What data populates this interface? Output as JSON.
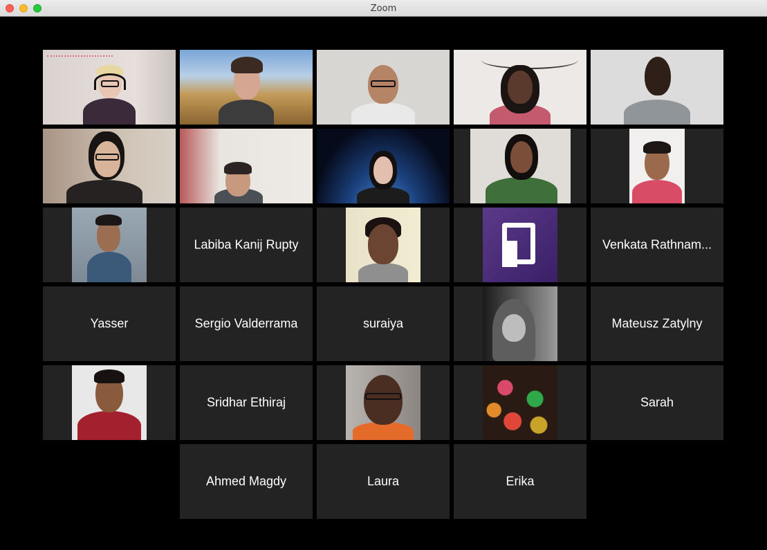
{
  "window": {
    "title": "Zoom"
  },
  "participants": [
    {
      "name": "",
      "type": "video",
      "active": true
    },
    {
      "name": "",
      "type": "video"
    },
    {
      "name": "",
      "type": "video"
    },
    {
      "name": "",
      "type": "video"
    },
    {
      "name": "",
      "type": "video"
    },
    {
      "name": "",
      "type": "video"
    },
    {
      "name": "",
      "type": "video"
    },
    {
      "name": "",
      "type": "video"
    },
    {
      "name": "",
      "type": "video"
    },
    {
      "name": "",
      "type": "video"
    },
    {
      "name": "",
      "type": "photo"
    },
    {
      "name": "Labiba Kanij Rupty",
      "type": "name"
    },
    {
      "name": "",
      "type": "photo"
    },
    {
      "name": "",
      "type": "logo"
    },
    {
      "name": "Venkata Rathnam...",
      "type": "name"
    },
    {
      "name": "Yasser",
      "type": "name"
    },
    {
      "name": "Sergio Valderrama",
      "type": "name"
    },
    {
      "name": "suraiya",
      "type": "name"
    },
    {
      "name": "",
      "type": "photo"
    },
    {
      "name": "Mateusz Zatylny",
      "type": "name"
    },
    {
      "name": "",
      "type": "photo"
    },
    {
      "name": "Sridhar Ethiraj",
      "type": "name"
    },
    {
      "name": "",
      "type": "photo"
    },
    {
      "name": "",
      "type": "photo"
    },
    {
      "name": "Sarah",
      "type": "name"
    },
    {
      "name": "Ahmed Magdy",
      "type": "name"
    },
    {
      "name": "Laura",
      "type": "name"
    },
    {
      "name": "Erika",
      "type": "name"
    }
  ],
  "colors": {
    "tile_bg": "#232323",
    "active_border": "#a8e05f",
    "window_bg": "#000000"
  }
}
